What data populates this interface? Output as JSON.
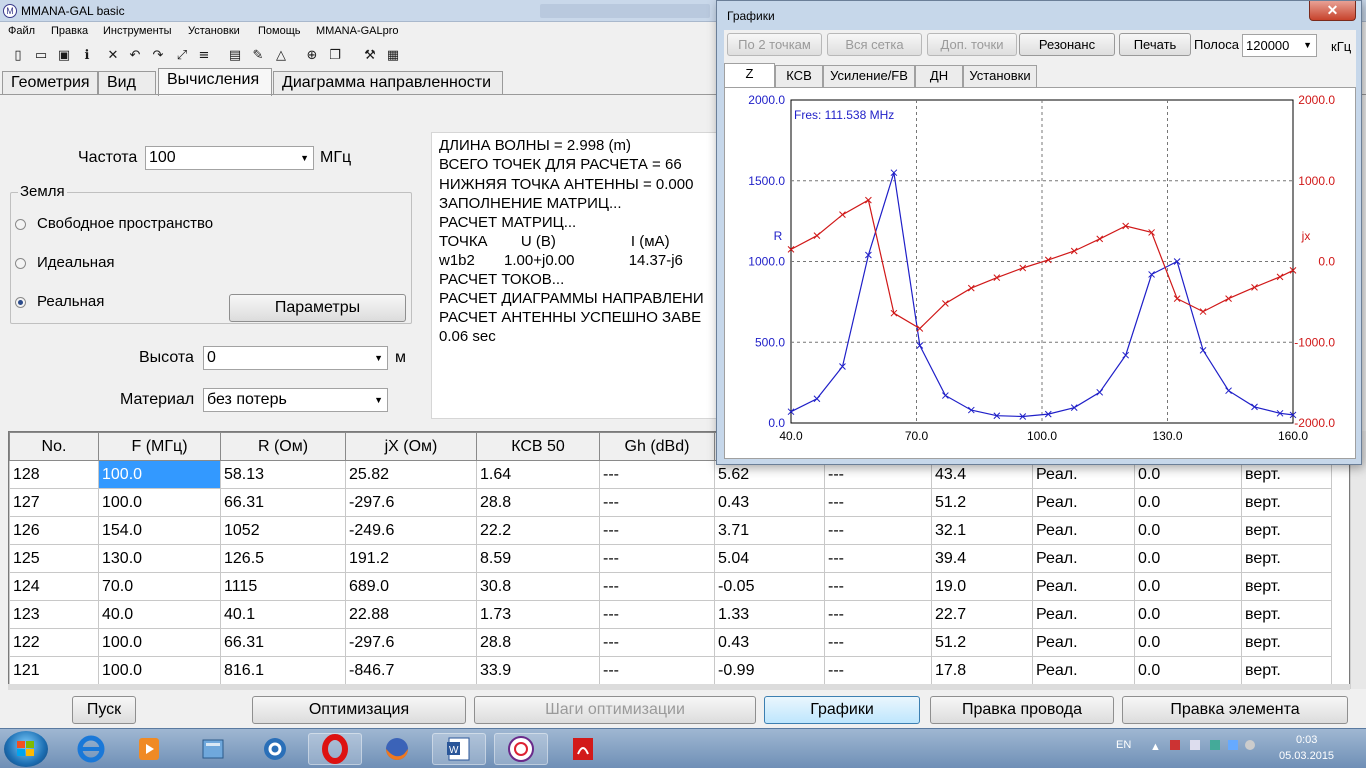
{
  "main": {
    "title": "MMANA-GAL basic",
    "menu": [
      "Файл",
      "Правка",
      "Инструменты",
      "Установки",
      "Помощь",
      "MMANA-GALpro"
    ],
    "tabs": [
      "Геометрия",
      "Вид",
      "Вычисления",
      "Диаграмма направленности"
    ],
    "active_tab": "Вычисления",
    "freq_label": "Частота",
    "freq_value": "100",
    "freq_unit": "МГц",
    "ground_group": "Земля",
    "ground_options": [
      "Свободное пространство",
      "Идеальная",
      "Реальная"
    ],
    "ground_selected": "Реальная",
    "params_button": "Параметры",
    "height_label": "Высота",
    "height_value": "0",
    "height_unit": "м",
    "material_label": "Материал",
    "material_value": "без потерь",
    "log": [
      "ДЛИНА ВОЛНЫ = 2.998 (m)",
      "ВСЕГО ТОЧЕК ДЛЯ РАСЧЕТА = 66",
      "НИЖНЯЯ ТОЧКА АНТЕННЫ = 0.000",
      "ЗАПОЛНЕНИЕ МАТРИЦ...",
      "РАСЧЕТ МАТРИЦ...",
      "ТОЧКА        U (В)                  I (мА)",
      "w1b2       1.00+j0.00             14.37-j6",
      "РАСЧЕТ ТОКОВ...",
      "РАСЧЕТ ДИАГРАММЫ НАПРАВЛЕНИ",
      "РАСЧЕТ АНТЕННЫ УСПЕШНО ЗАВЕ",
      "0.06 sec"
    ],
    "table": {
      "headers": [
        "No.",
        "F (МГц)",
        "R (Ом)",
        "jX (Ом)",
        "КСВ 50",
        "Gh (dBd)",
        "",
        "",
        "",
        "",
        "",
        ""
      ],
      "rows": [
        [
          "128",
          "100.0",
          "58.13",
          "25.82",
          "1.64",
          "---",
          "5.62",
          "---",
          "43.4",
          "Реал.",
          "0.0",
          "верт."
        ],
        [
          "127",
          "100.0",
          "66.31",
          "-297.6",
          "28.8",
          "---",
          "0.43",
          "---",
          "51.2",
          "Реал.",
          "0.0",
          "верт."
        ],
        [
          "126",
          "154.0",
          "1052",
          "-249.6",
          "22.2",
          "---",
          "3.71",
          "---",
          "32.1",
          "Реал.",
          "0.0",
          "верт."
        ],
        [
          "125",
          "130.0",
          "126.5",
          "191.2",
          "8.59",
          "---",
          "5.04",
          "---",
          "39.4",
          "Реал.",
          "0.0",
          "верт."
        ],
        [
          "124",
          "70.0",
          "1115",
          "689.0",
          "30.8",
          "---",
          "-0.05",
          "---",
          "19.0",
          "Реал.",
          "0.0",
          "верт."
        ],
        [
          "123",
          "40.0",
          "40.1",
          "22.88",
          "1.73",
          "---",
          "1.33",
          "---",
          "22.7",
          "Реал.",
          "0.0",
          "верт."
        ],
        [
          "122",
          "100.0",
          "66.31",
          "-297.6",
          "28.8",
          "---",
          "0.43",
          "---",
          "51.2",
          "Реал.",
          "0.0",
          "верт."
        ],
        [
          "121",
          "100.0",
          "816.1",
          "-846.7",
          "33.9",
          "---",
          "-0.99",
          "---",
          "17.8",
          "Реал.",
          "0.0",
          "верт."
        ]
      ]
    },
    "bottom_buttons": [
      "Пуск",
      "Оптимизация",
      "Шаги оптимизации",
      "Графики",
      "Правка провода",
      "Правка элемента"
    ]
  },
  "graphs": {
    "title": "Графики",
    "close_glyph": "✕",
    "buttons": [
      "По 2 точкам",
      "Вся сетка",
      "Доп. точки",
      "Резонанс",
      "Печать"
    ],
    "band_label": "Полоса",
    "band_value": "120000",
    "band_unit": "кГц",
    "tabs": [
      "Z",
      "КСВ",
      "Усиление/FB",
      "ДН",
      "Установки"
    ],
    "active_tab": "Z",
    "fres_text": "Fres: 111.538 MHz"
  },
  "chart_data": {
    "type": "line",
    "x_ticks": [
      "40.0",
      "70.0",
      "100.0",
      "130.0",
      "160.0"
    ],
    "xlim": [
      40,
      160
    ],
    "ylim_left": [
      0,
      2000
    ],
    "ylim_right": [
      -2000,
      2000
    ],
    "y_left_ticks": [
      "0.0",
      "500.0",
      "1000.0",
      "1500.0",
      "2000.0"
    ],
    "y_right_ticks": [
      "-2000.0",
      "-1000.0",
      "0.0",
      "1000.0",
      "2000.0"
    ],
    "left_label": "R",
    "right_label": "jx",
    "grid": true,
    "series": [
      {
        "name": "R",
        "axis": "left",
        "color": "#1f1fc8",
        "x": [
          40,
          46.2,
          52.3,
          58.5,
          64.6,
          70.8,
          76.9,
          83.1,
          89.2,
          95.4,
          101.5,
          107.7,
          113.8,
          120,
          126.2,
          132.3,
          138.5,
          144.6,
          150.8,
          156.9,
          160
        ],
        "values": [
          70,
          150,
          350,
          1040,
          1550,
          480,
          170,
          80,
          45,
          40,
          55,
          95,
          190,
          420,
          920,
          1000,
          450,
          200,
          100,
          60,
          50
        ]
      },
      {
        "name": "jx",
        "axis": "right",
        "color": "#d01818",
        "x": [
          40,
          46.2,
          52.3,
          58.5,
          64.6,
          70.8,
          76.9,
          83.1,
          89.2,
          95.4,
          101.5,
          107.7,
          113.8,
          120,
          126.2,
          132.3,
          138.5,
          144.6,
          150.8,
          156.9,
          160
        ],
        "values": [
          150,
          320,
          580,
          760,
          -640,
          -830,
          -520,
          -330,
          -200,
          -80,
          20,
          130,
          280,
          440,
          360,
          -460,
          -620,
          -460,
          -320,
          -190,
          -110
        ]
      }
    ]
  },
  "taskbar": {
    "lang": "EN",
    "time": "0:03",
    "date": "05.03.2015",
    "apps": [
      "ie-icon",
      "media-player-icon",
      "library-icon",
      "skype-icon",
      "opera-icon",
      "firefox-icon",
      "word-icon",
      "mmana-icon",
      "acrobat-icon"
    ]
  },
  "colors": {
    "accent": "#3399ff",
    "r_series": "#1f1fc8",
    "jx_series": "#d01818"
  }
}
